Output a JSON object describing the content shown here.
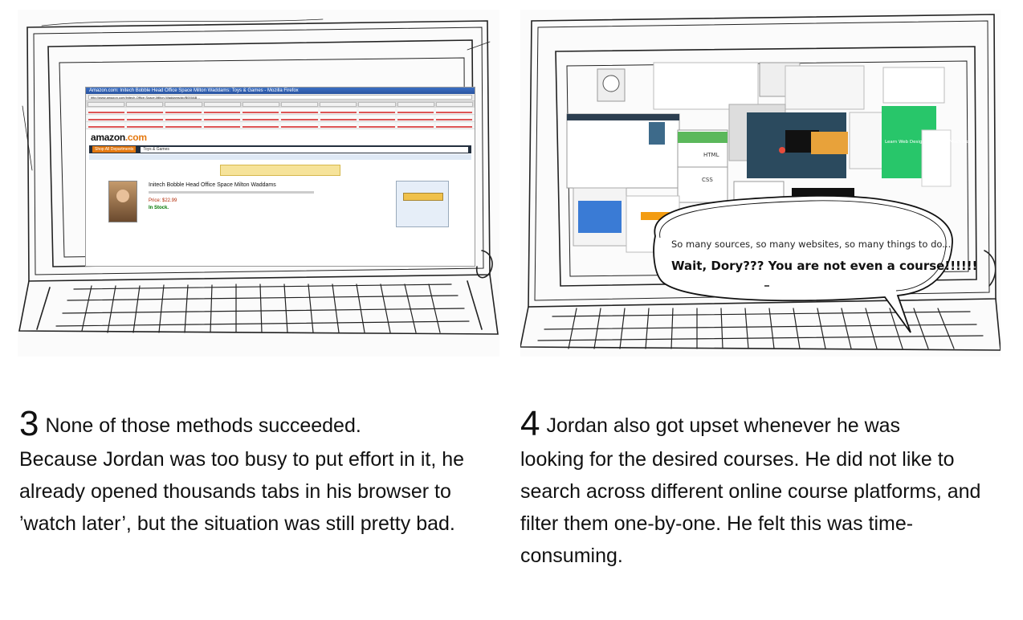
{
  "panels": [
    {
      "number": "3",
      "lead": "None of those methods succeeded.",
      "body": "Because Jordan was too busy to put effort in it, he already opened thousands tabs in his browser to ’watch later’, but the situation was still pretty bad.",
      "sketch": {
        "window_title": "Amazon.com: Initech Bobble Head Office Space Milton Waddams: Toys & Games - Mozilla Firefox",
        "url": "http://www.amazon.com/Initech-Office-Space-Milton-Waddams/dp/B000AB…",
        "logo": "amazon",
        "logo_suffix": ".com",
        "department": "Shop All Departments",
        "search_value": "Toys & Games",
        "product_title": "Initech Bobble Head Office Space Milton Waddams",
        "price": "Price: $22.99",
        "stock": "In Stock."
      }
    },
    {
      "number": "4",
      "lead": "Jordan also got upset whenever he was",
      "body": "looking for the desired courses. He did not like to search across different online course platforms, and filter them one-by-one. He felt this was time-consuming.",
      "sketch": {
        "bubble_line1": "So many sources, so many websites, so many things to do...",
        "bubble_line2": "Wait, Dory??? You are not even a course!!!!!!",
        "card_labels": [
          "HTML",
          "CSS",
          "Learn Web Design, Coding & Much More"
        ]
      }
    }
  ]
}
